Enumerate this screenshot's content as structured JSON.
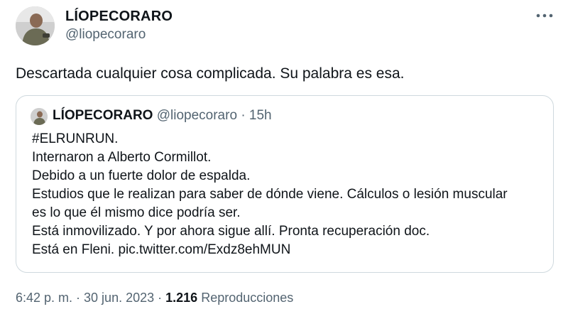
{
  "author": {
    "display_name": "LÍOPECORARO",
    "handle": "@liopecoraro",
    "avatar_icon": "person-photo-avatar"
  },
  "more_icon": "more-dots-icon",
  "tweet": {
    "text": "Descartada cualquier cosa complicada. Su palabra es esa."
  },
  "quoted_tweet": {
    "display_name": "LÍOPECORARO",
    "handle": "@liopecoraro",
    "separator": "·",
    "time": "15h",
    "lines": [
      "#ELRUNRUN.",
      "Internaron a Alberto Cormillot.",
      "Debido a un fuerte dolor de espalda.",
      "Estudios que le realizan para saber de dónde viene. Cálculos o lesión muscular",
      "es lo que él mismo dice podría ser.",
      "Está inmovilizado. Y por ahora sigue allí. Pronta recuperación doc.",
      "Está en Fleni. pic.twitter.com/Exdz8ehMUN"
    ]
  },
  "meta": {
    "timestamp": "6:42 p. m. · 30 jun. 2023 ·",
    "views_count": "1.216",
    "views_label": "Reproducciones"
  },
  "colors": {
    "text": "#0f1419",
    "secondary": "#536471",
    "border": "#cfd9de"
  }
}
